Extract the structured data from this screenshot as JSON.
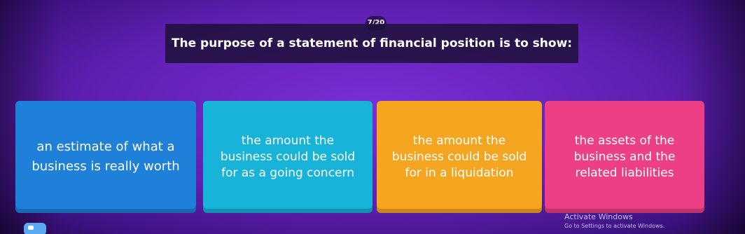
{
  "counter": "7/20",
  "question": "The purpose of a statement of financial position is to show:",
  "options": [
    {
      "label": "an estimate of what a\nbusiness is really worth",
      "color": "#1e80d8"
    },
    {
      "label": "the amount the\nbusiness could be sold\nfor as a going concern",
      "color": "#17b3d8"
    },
    {
      "label": "the amount the\nbusiness could be sold\nfor in a liquidation",
      "color": "#f6a520"
    },
    {
      "label": "the assets of the\nbusiness and the\nrelated liabilities",
      "color": "#ec3f86"
    }
  ],
  "watermark": {
    "title": "Activate Windows",
    "subtitle": "Go to Settings to activate Windows."
  },
  "colors": {
    "background": "#5e1fb0",
    "question_bg": "#1c1034"
  },
  "icons": {
    "corner": "game-logo-icon"
  }
}
